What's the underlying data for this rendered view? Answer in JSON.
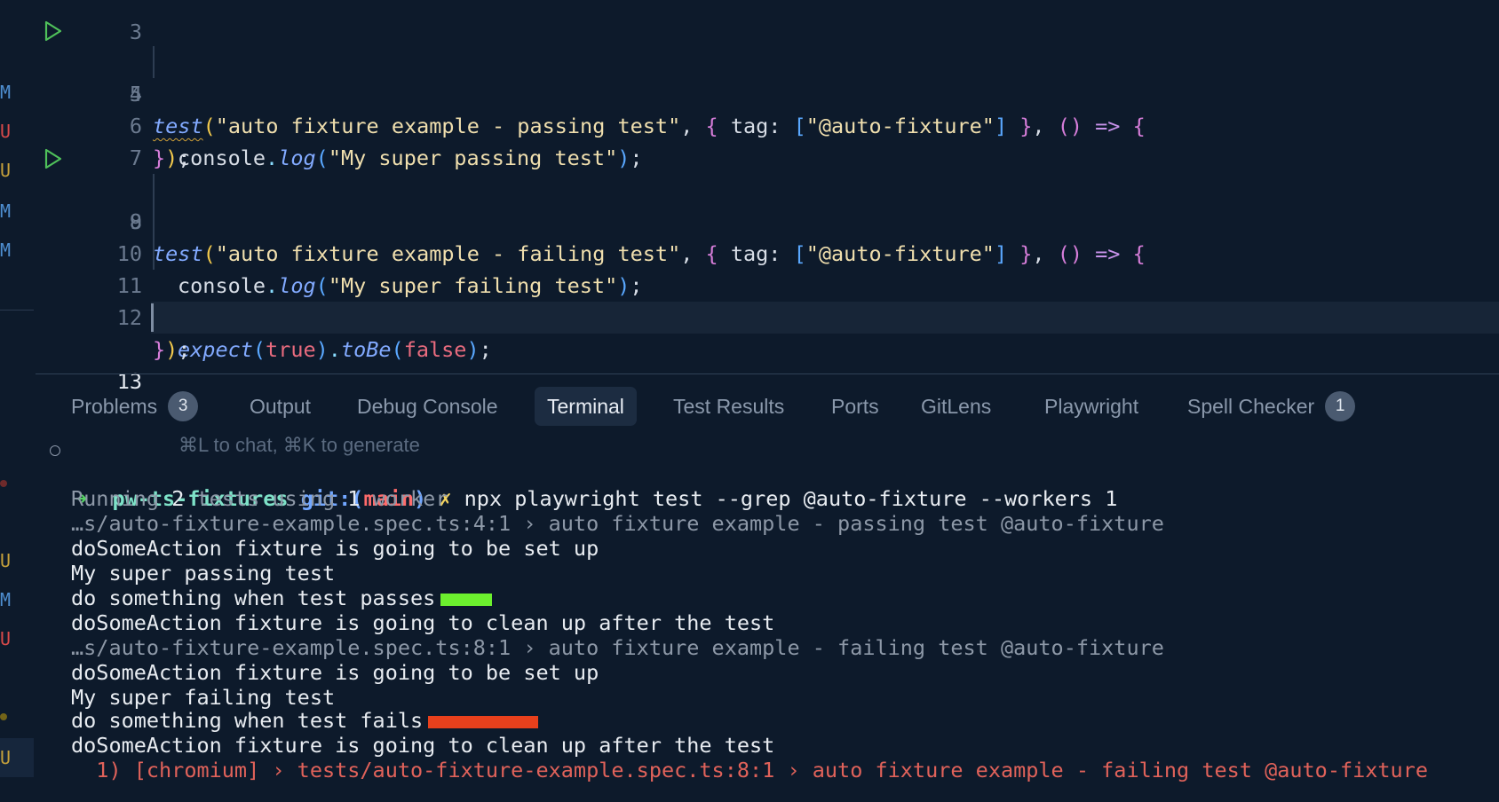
{
  "editor": {
    "lines": [
      {
        "num": "3"
      },
      {
        "num": "4",
        "t1": "test",
        "t2": "(",
        "t3": "\"auto fixture example - passing test\"",
        "t4": ", ",
        "t5": "{",
        "t6": " tag: ",
        "t7": "[",
        "t8": "\"@auto-fixture\"",
        "t9": "]",
        "t10": " }",
        "t11": ", ",
        "t12": "()",
        "t13": " => ",
        "t14": "{"
      },
      {
        "num": "5",
        "t1": "console",
        "t2": ".",
        "t3": "log",
        "t4": "(",
        "t5": "\"My super passing test\"",
        "t6": ")",
        "t7": ";"
      },
      {
        "num": "6",
        "t1": "}",
        "t2": ")",
        "t3": ";"
      },
      {
        "num": "7"
      },
      {
        "num": "8",
        "t1": "test",
        "t2": "(",
        "t3": "\"auto fixture example - failing test\"",
        "t4": ", ",
        "t5": "{",
        "t6": " tag: ",
        "t7": "[",
        "t8": "\"@auto-fixture\"",
        "t9": "]",
        "t10": " }",
        "t11": ", ",
        "t12": "()",
        "t13": " => ",
        "t14": "{"
      },
      {
        "num": "9",
        "t1": "console",
        "t2": ".",
        "t3": "log",
        "t4": "(",
        "t5": "\"My super failing test\"",
        "t6": ")",
        "t7": ";"
      },
      {
        "num": "10"
      },
      {
        "num": "11",
        "t1": "expect",
        "t2": "(",
        "t3": "true",
        "t4": ")",
        "t5": ".",
        "t6": "toBe",
        "t7": "(",
        "t8": "false",
        "t9": ")",
        "t10": ";"
      },
      {
        "num": "12",
        "t1": "}",
        "t2": ")",
        "t3": ";"
      },
      {
        "num": "13",
        "hint": "⌘L to chat, ⌘K to generate"
      }
    ]
  },
  "left_markers": [
    "M",
    "U",
    "U",
    "M",
    "M",
    "U",
    "M",
    "U",
    "U"
  ],
  "panel": {
    "tabs": [
      {
        "label": "Problems",
        "badge": "3"
      },
      {
        "label": "Output"
      },
      {
        "label": "Debug Console"
      },
      {
        "label": "Terminal",
        "active": true
      },
      {
        "label": "Test Results"
      },
      {
        "label": "Ports"
      },
      {
        "label": "GitLens"
      },
      {
        "label": "Playwright"
      },
      {
        "label": "Spell Checker",
        "badge": "1"
      }
    ]
  },
  "terminal": {
    "prompt": {
      "arrow": "➜",
      "dir": "pw-ts-fixtures",
      "git_label": "git:(",
      "branch": "main",
      "git_close": ")",
      "dirty": "✗",
      "command": "npx playwright test --grep @auto-fixture --workers 1"
    },
    "running": {
      "p1": "Running ",
      "n1": "2",
      "p2": " tests using ",
      "n2": "1",
      "p3": " worker"
    },
    "lines": [
      "…s/auto-fixture-example.spec.ts:4:1 › auto fixture example - passing test @auto-fixture",
      "doSomeAction fixture is going to be set up",
      "My super passing test",
      "do something when test passes",
      "doSomeAction fixture is going to clean up after the test",
      "…s/auto-fixture-example.spec.ts:8:1 › auto fixture example - failing test @auto-fixture",
      "doSomeAction fixture is going to be set up",
      "My super failing test",
      "do something when test fails",
      "doSomeAction fixture is going to clean up after the test",
      "  1) [chromium] › tests/auto-fixture-example.spec.ts:8:1 › auto fixture example - failing test @auto-fixture"
    ],
    "pass_color": "#6cf02e",
    "fail_color": "#e8401c"
  }
}
